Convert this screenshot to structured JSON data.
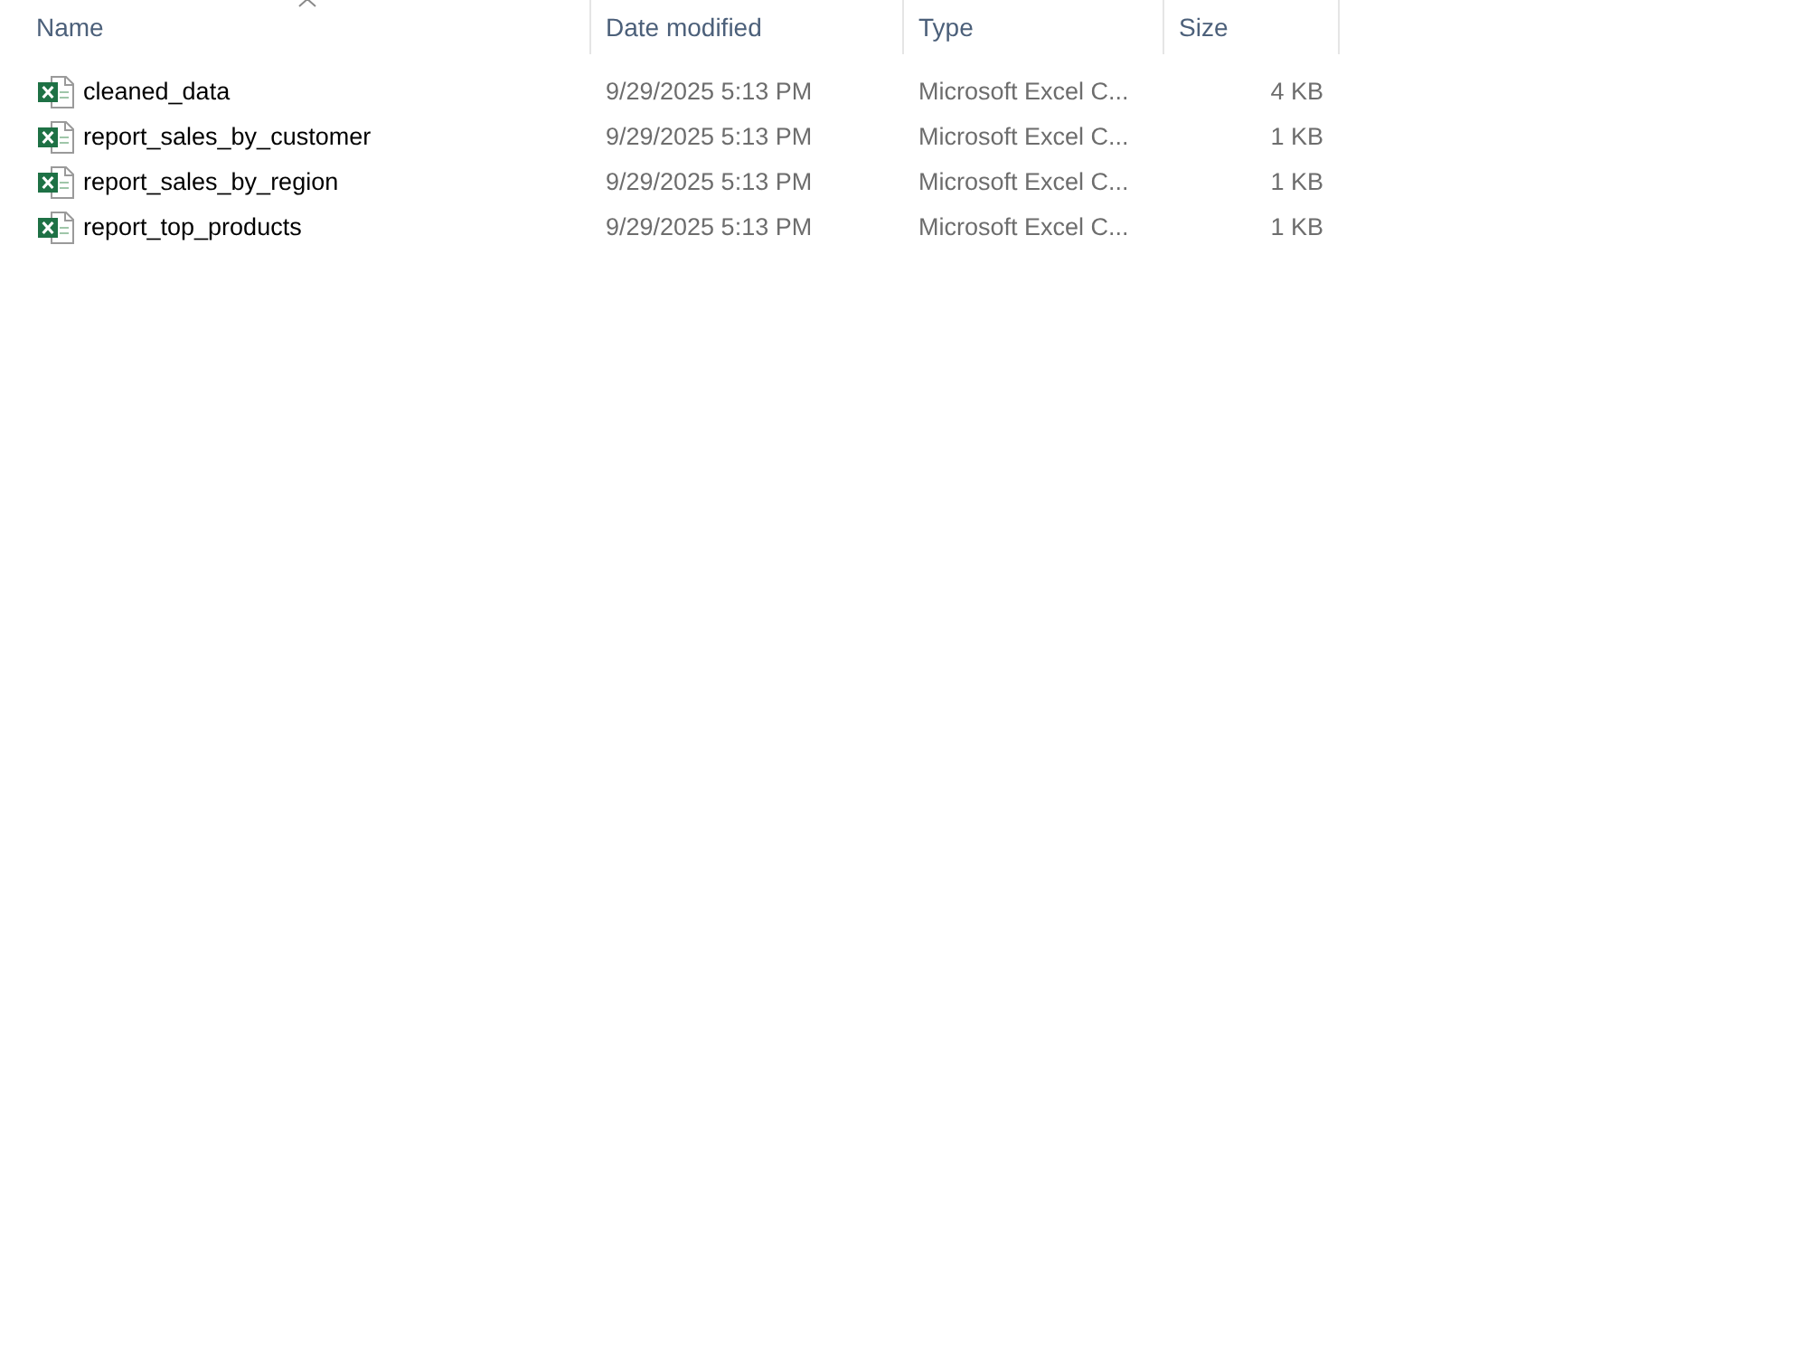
{
  "columns": [
    {
      "label": "Name",
      "sorted": true
    },
    {
      "label": "Date modified",
      "sorted": false
    },
    {
      "label": "Type",
      "sorted": false
    },
    {
      "label": "Size",
      "sorted": false
    }
  ],
  "files": [
    {
      "name": "cleaned_data",
      "date_modified": "9/29/2025 5:13 PM",
      "type": "Microsoft Excel C...",
      "size": "4 KB"
    },
    {
      "name": "report_sales_by_customer",
      "date_modified": "9/29/2025 5:13 PM",
      "type": "Microsoft Excel C...",
      "size": "1 KB"
    },
    {
      "name": "report_sales_by_region",
      "date_modified": "9/29/2025 5:13 PM",
      "type": "Microsoft Excel C...",
      "size": "1 KB"
    },
    {
      "name": "report_top_products",
      "date_modified": "9/29/2025 5:13 PM",
      "type": "Microsoft Excel C...",
      "size": "1 KB"
    }
  ]
}
